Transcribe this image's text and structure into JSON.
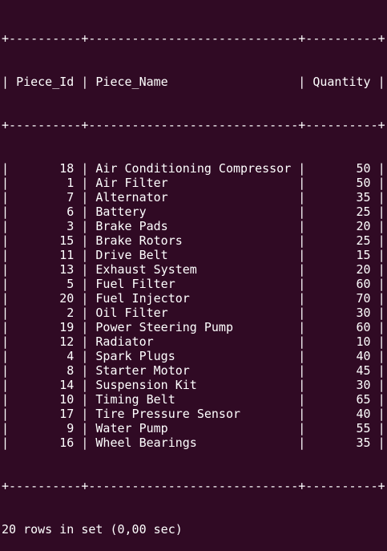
{
  "table": {
    "border_line": "+----------+-----------------------------+----------+",
    "columns": [
      "Piece_Id",
      "Piece_Name",
      "Quantity"
    ],
    "rows": [
      [
        "18",
        "Air Conditioning Compressor",
        "50"
      ],
      [
        "1",
        "Air Filter",
        "50"
      ],
      [
        "7",
        "Alternator",
        "35"
      ],
      [
        "6",
        "Battery",
        "25"
      ],
      [
        "3",
        "Brake Pads",
        "20"
      ],
      [
        "15",
        "Brake Rotors",
        "25"
      ],
      [
        "11",
        "Drive Belt",
        "15"
      ],
      [
        "13",
        "Exhaust System",
        "20"
      ],
      [
        "5",
        "Fuel Filter",
        "60"
      ],
      [
        "20",
        "Fuel Injector",
        "70"
      ],
      [
        "2",
        "Oil Filter",
        "30"
      ],
      [
        "19",
        "Power Steering Pump",
        "60"
      ],
      [
        "12",
        "Radiator",
        "10"
      ],
      [
        "4",
        "Spark Plugs",
        "40"
      ],
      [
        "8",
        "Starter Motor",
        "45"
      ],
      [
        "14",
        "Suspension Kit",
        "30"
      ],
      [
        "10",
        "Timing Belt",
        "65"
      ],
      [
        "17",
        "Tire Pressure Sensor",
        "40"
      ],
      [
        "9",
        "Water Pump",
        "55"
      ],
      [
        "16",
        "Wheel Bearings",
        "35"
      ]
    ]
  },
  "status_line": "20 rows in set (0,00 sec)",
  "colors": {
    "background": "#300a24",
    "text": "#ffffff"
  }
}
